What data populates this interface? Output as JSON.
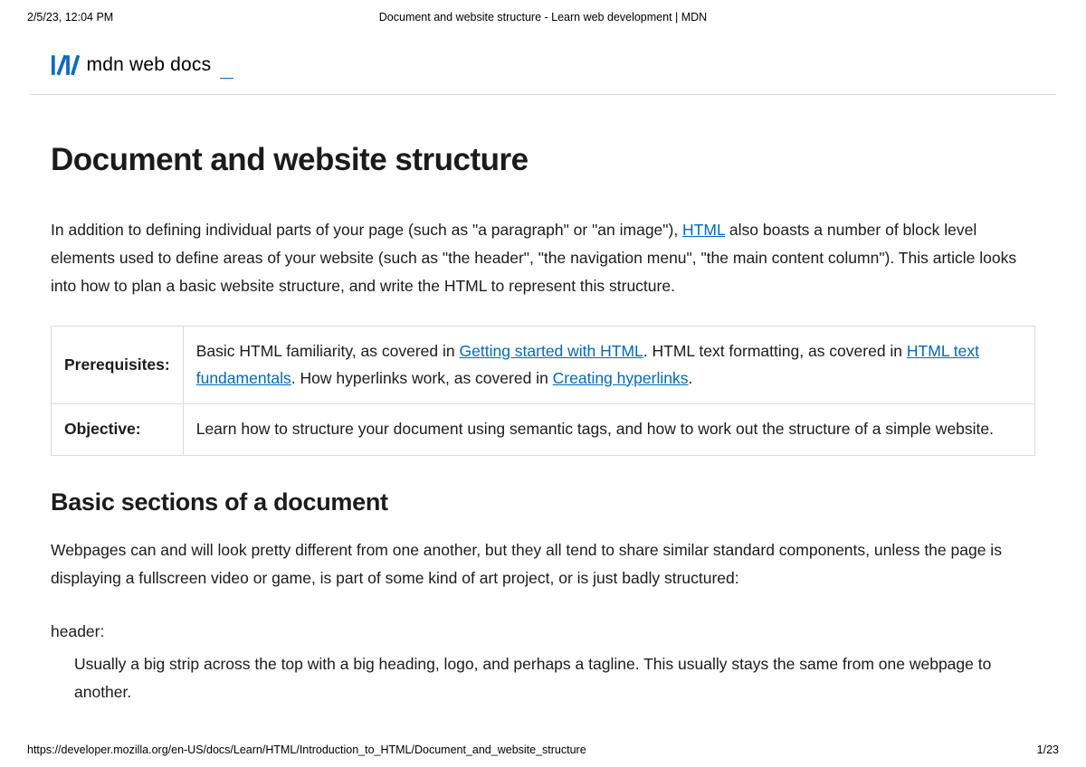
{
  "print": {
    "timestamp": "2/5/23, 12:04 PM",
    "title": "Document and website structure - Learn web development | MDN",
    "url": "https://developer.mozilla.org/en-US/docs/Learn/HTML/Introduction_to_HTML/Document_and_website_structure",
    "page": "1/23"
  },
  "logo": {
    "text": "mdn web docs",
    "cursor": "_"
  },
  "article": {
    "title": "Document and website structure",
    "intro_1": "In addition to defining individual parts of your page (such as \"a paragraph\" or \"an image\"), ",
    "intro_link_html": "HTML",
    "intro_2": " also boasts a number of block level elements used to define areas of your website (such as \"the header\", \"the navigation menu\", \"the main content column\"). This article looks into how to plan a basic website structure, and write the HTML to represent this structure."
  },
  "table": {
    "prereq_label": "Prerequisites:",
    "prereq_1": "Basic HTML familiarity, as covered in ",
    "prereq_link1": "Getting started with HTML",
    "prereq_2": ". HTML text formatting, as covered in ",
    "prereq_link2": "HTML text fundamentals",
    "prereq_3": ". How hyperlinks work, as covered in ",
    "prereq_link3": "Creating hyperlinks",
    "prereq_4": ".",
    "objective_label": "Objective:",
    "objective_value": "Learn how to structure your document using semantic tags, and how to work out the structure of a simple website."
  },
  "section": {
    "heading": "Basic sections of a document",
    "para": "Webpages can and will look pretty different from one another, but they all tend to share similar standard components, unless the page is displaying a fullscreen video or game, is part of some kind of art project, or is just badly structured:",
    "dt_header": "header:",
    "dd_header": "Usually a big strip across the top with a big heading, logo, and perhaps a tagline. This usually stays the same from one webpage to another."
  }
}
